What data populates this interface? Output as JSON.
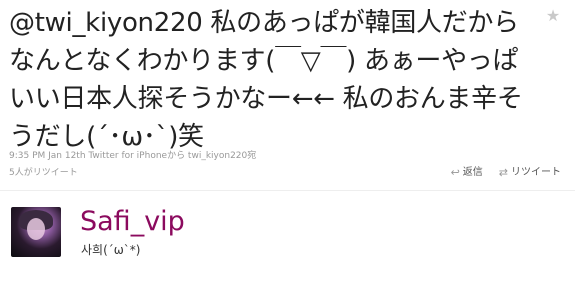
{
  "tweet": {
    "text": "@twi_kiyon220 私のあっぱが韓国人だからなんとなくわかります(￣▽￣) あぁーやっぱいい日本人探そうかなー←← 私のおんま辛そうだし(´･ω･`)笑",
    "time": "9:35 PM Jan 12th",
    "via": "Twitter for iPhone",
    "reply_to_text": "から twi_kiyon220宛",
    "retweet_count_text": "5人がリツイート",
    "star_icon": "star-icon"
  },
  "actions": {
    "reply_label": "返信",
    "retweet_label": "リツイート",
    "reply_icon": "reply-icon",
    "retweet_icon": "retweet-icon"
  },
  "user": {
    "name": "Safi_vip",
    "bio": "사희(´ω`*)"
  },
  "colors": {
    "username": "#8b0a5e",
    "meta": "#999999",
    "text": "#222222"
  }
}
